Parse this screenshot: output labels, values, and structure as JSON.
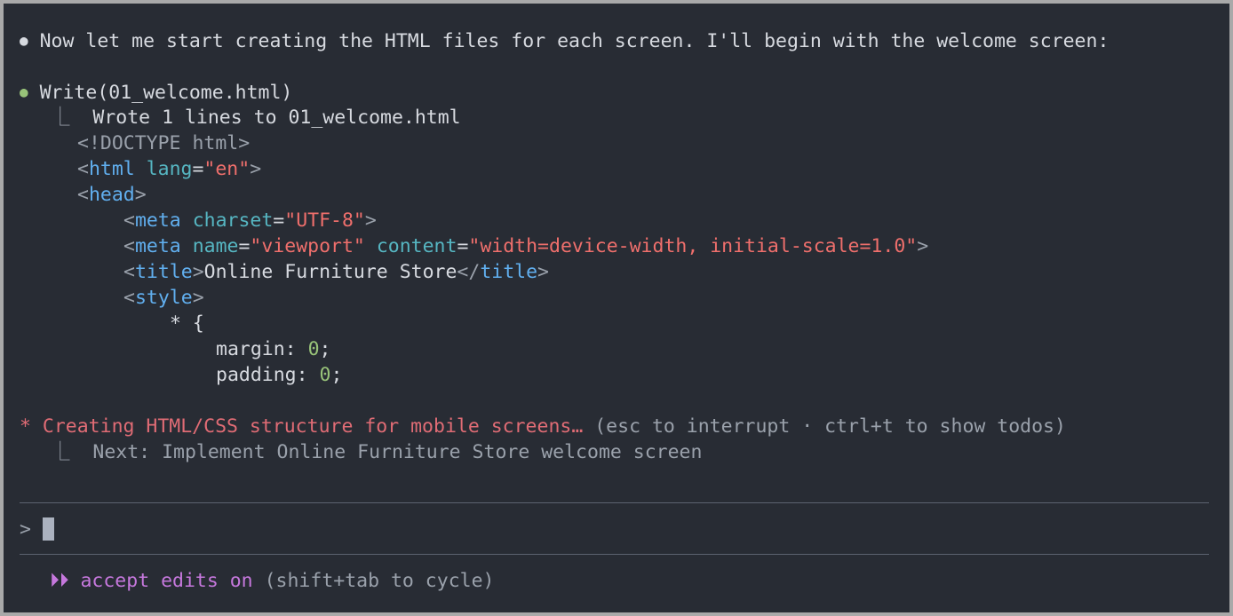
{
  "messages": {
    "intro": "Now let me start creating the HTML files for each screen. I'll begin with the welcome screen:",
    "tool_call": "Write(01_welcome.html)",
    "tool_result": "Wrote 1 lines to 01_welcome.html"
  },
  "code_lines": [
    {
      "tokens": [
        {
          "t": "<!DOCTYPE html>",
          "c": "gray"
        }
      ]
    },
    {
      "tokens": [
        {
          "t": "<",
          "c": "gray"
        },
        {
          "t": "html",
          "c": "tag"
        },
        {
          "t": " ",
          "c": "white"
        },
        {
          "t": "lang",
          "c": "attr"
        },
        {
          "t": "=",
          "c": "white"
        },
        {
          "t": "\"en\"",
          "c": "str"
        },
        {
          "t": ">",
          "c": "gray"
        }
      ]
    },
    {
      "tokens": [
        {
          "t": "<",
          "c": "gray"
        },
        {
          "t": "head",
          "c": "tag"
        },
        {
          "t": ">",
          "c": "gray"
        }
      ]
    },
    {
      "tokens": [
        {
          "t": "<",
          "c": "gray"
        },
        {
          "t": "meta",
          "c": "tag"
        },
        {
          "t": " ",
          "c": "white"
        },
        {
          "t": "charset",
          "c": "attr"
        },
        {
          "t": "=",
          "c": "white"
        },
        {
          "t": "\"UTF-8\"",
          "c": "str"
        },
        {
          "t": ">",
          "c": "gray"
        }
      ]
    },
    {
      "tokens": [
        {
          "t": "<",
          "c": "gray"
        },
        {
          "t": "meta",
          "c": "tag"
        },
        {
          "t": " ",
          "c": "white"
        },
        {
          "t": "name",
          "c": "attr"
        },
        {
          "t": "=",
          "c": "white"
        },
        {
          "t": "\"viewport\"",
          "c": "str"
        },
        {
          "t": " ",
          "c": "white"
        },
        {
          "t": "content",
          "c": "attr"
        },
        {
          "t": "=",
          "c": "white"
        },
        {
          "t": "\"width=device-width, initial-scale=1.0\"",
          "c": "str"
        },
        {
          "t": ">",
          "c": "gray"
        }
      ]
    },
    {
      "tokens": [
        {
          "t": "<",
          "c": "gray"
        },
        {
          "t": "title",
          "c": "tag"
        },
        {
          "t": ">",
          "c": "gray"
        },
        {
          "t": "Online Furniture Store",
          "c": "white"
        },
        {
          "t": "</",
          "c": "gray"
        },
        {
          "t": "title",
          "c": "tag"
        },
        {
          "t": ">",
          "c": "gray"
        }
      ]
    },
    {
      "tokens": [
        {
          "t": "<",
          "c": "gray"
        },
        {
          "t": "style",
          "c": "tag"
        },
        {
          "t": ">",
          "c": "gray"
        }
      ]
    },
    {
      "tokens": [
        {
          "t": "* {",
          "c": "white"
        }
      ]
    },
    {
      "tokens": [
        {
          "t": "margin: ",
          "c": "white"
        },
        {
          "t": "0",
          "c": "num"
        },
        {
          "t": ";",
          "c": "white"
        }
      ]
    },
    {
      "tokens": [
        {
          "t": "padding: ",
          "c": "white"
        },
        {
          "t": "0",
          "c": "num"
        },
        {
          "t": ";",
          "c": "white"
        }
      ]
    }
  ],
  "status": {
    "spinner": "*",
    "activity": "Creating HTML/CSS structure for mobile screens…",
    "hint": "(esc to interrupt · ctrl+t to show todos)",
    "next_label": "Next: Implement Online Furniture Store welcome screen"
  },
  "prompt": {
    "symbol": ">",
    "value": ""
  },
  "footer": {
    "mode_icon": "fast-forward-icon",
    "mode_label": "accept edits on",
    "mode_hint": "(shift+tab to cycle)"
  },
  "colors": {
    "background": "#282c34",
    "green_bullet": "#98c379",
    "status_red": "#e06c75",
    "mode_purple": "#c678dd"
  }
}
